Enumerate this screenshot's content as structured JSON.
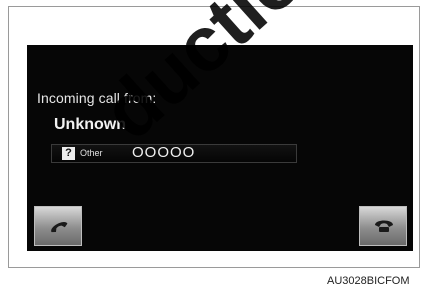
{
  "screen": {
    "prompt": "Incoming call from:",
    "caller_name": "Unknown",
    "number_type": "Other",
    "number": "OOOOO"
  },
  "buttons": {
    "answer": "phone-answer-icon",
    "decline": "phone-hangup-icon"
  },
  "figure_code": "AU3028BICFOM",
  "watermark_text": "duction"
}
